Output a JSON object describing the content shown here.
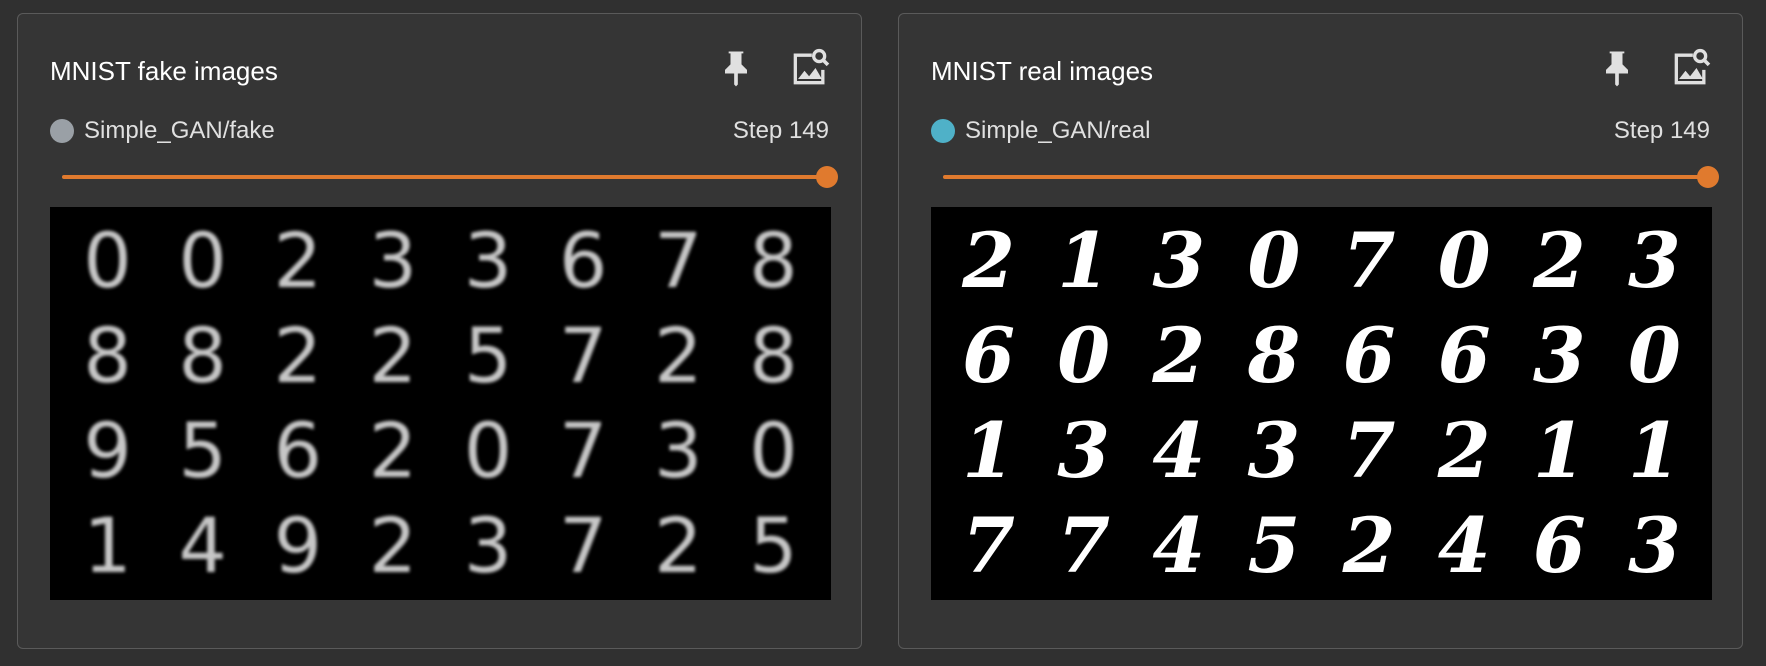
{
  "cards": [
    {
      "title": "MNIST fake images",
      "run_name": "Simple_GAN/fake",
      "run_color": "#9aa0a6",
      "step_label": "Step 149",
      "slider_value": 1.0,
      "slider_color": "#e07a2e",
      "pin_icon": "pin-icon",
      "expand_icon": "image-search-icon",
      "image_grid": [
        [
          "0",
          "0",
          "2",
          "3",
          "3",
          "6",
          "7",
          "8"
        ],
        [
          "8",
          "8",
          "2",
          "2",
          "5",
          "7",
          "2",
          "8"
        ],
        [
          "9",
          "5",
          "6",
          "2",
          "0",
          "7",
          "3",
          "0"
        ],
        [
          "1",
          "4",
          "9",
          "2",
          "3",
          "7",
          "2",
          "5"
        ]
      ]
    },
    {
      "title": "MNIST real images",
      "run_name": "Simple_GAN/real",
      "run_color": "#4fb1c8",
      "step_label": "Step 149",
      "slider_value": 1.0,
      "slider_color": "#e07a2e",
      "pin_icon": "pin-icon",
      "expand_icon": "image-search-icon",
      "image_grid": [
        [
          "2",
          "1",
          "3",
          "0",
          "7",
          "0",
          "2",
          "3"
        ],
        [
          "6",
          "0",
          "2",
          "8",
          "6",
          "6",
          "3",
          "0"
        ],
        [
          "1",
          "3",
          "4",
          "3",
          "7",
          "2",
          "1",
          "1"
        ],
        [
          "7",
          "7",
          "4",
          "5",
          "2",
          "4",
          "6",
          "3"
        ]
      ]
    }
  ]
}
